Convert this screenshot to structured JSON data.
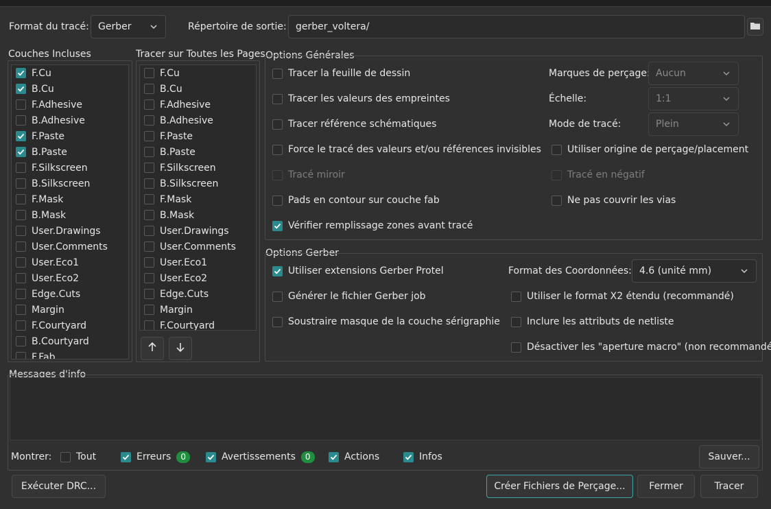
{
  "header": {
    "format_label": "Format du tracé:",
    "format_value": "Gerber",
    "output_dir_label": "Répertoire de sortie:",
    "output_dir_value": "gerber_voltera/"
  },
  "included_layers": {
    "title": "Couches Incluses",
    "items": [
      {
        "label": "F.Cu",
        "checked": true
      },
      {
        "label": "B.Cu",
        "checked": true
      },
      {
        "label": "F.Adhesive",
        "checked": false
      },
      {
        "label": "B.Adhesive",
        "checked": false
      },
      {
        "label": "F.Paste",
        "checked": true
      },
      {
        "label": "B.Paste",
        "checked": true
      },
      {
        "label": "F.Silkscreen",
        "checked": false
      },
      {
        "label": "B.Silkscreen",
        "checked": false
      },
      {
        "label": "F.Mask",
        "checked": false
      },
      {
        "label": "B.Mask",
        "checked": false
      },
      {
        "label": "User.Drawings",
        "checked": false
      },
      {
        "label": "User.Comments",
        "checked": false
      },
      {
        "label": "User.Eco1",
        "checked": false
      },
      {
        "label": "User.Eco2",
        "checked": false
      },
      {
        "label": "Edge.Cuts",
        "checked": false
      },
      {
        "label": "Margin",
        "checked": false
      },
      {
        "label": "F.Courtyard",
        "checked": false
      },
      {
        "label": "B.Courtyard",
        "checked": false
      },
      {
        "label": "F.Fab",
        "checked": false
      }
    ]
  },
  "all_pages_layers": {
    "title": "Tracer sur Toutes les Pages",
    "items": [
      {
        "label": "F.Cu",
        "checked": false
      },
      {
        "label": "B.Cu",
        "checked": false
      },
      {
        "label": "F.Adhesive",
        "checked": false
      },
      {
        "label": "B.Adhesive",
        "checked": false
      },
      {
        "label": "F.Paste",
        "checked": false
      },
      {
        "label": "B.Paste",
        "checked": false
      },
      {
        "label": "F.Silkscreen",
        "checked": false
      },
      {
        "label": "B.Silkscreen",
        "checked": false
      },
      {
        "label": "F.Mask",
        "checked": false
      },
      {
        "label": "B.Mask",
        "checked": false
      },
      {
        "label": "User.Drawings",
        "checked": false
      },
      {
        "label": "User.Comments",
        "checked": false
      },
      {
        "label": "User.Eco1",
        "checked": false
      },
      {
        "label": "User.Eco2",
        "checked": false
      },
      {
        "label": "Edge.Cuts",
        "checked": false
      },
      {
        "label": "Margin",
        "checked": false
      },
      {
        "label": "F.Courtyard",
        "checked": false
      }
    ]
  },
  "general": {
    "title": "Options Générales",
    "left_options": [
      {
        "label": "Tracer la feuille de dessin",
        "checked": false,
        "disabled": false
      },
      {
        "label": "Tracer les valeurs des empreintes",
        "checked": false,
        "disabled": false
      },
      {
        "label": "Tracer référence  schématiques",
        "checked": false,
        "disabled": false
      },
      {
        "label": "Force le tracé des valeurs et/ou références invisibles",
        "checked": false,
        "disabled": false
      },
      {
        "label": "Tracé miroir",
        "checked": false,
        "disabled": true
      },
      {
        "label": "Pads en contour sur couche fab",
        "checked": false,
        "disabled": false
      },
      {
        "label": "Vérifier remplissage zones avant tracé",
        "checked": true,
        "disabled": false
      }
    ],
    "drill_marks_label": "Marques de perçage:",
    "drill_marks_value": "Aucun",
    "scale_label": "Échelle:",
    "scale_value": "1:1",
    "plot_mode_label": "Mode de tracé:",
    "plot_mode_value": "Plein",
    "right_options": [
      {
        "label": "Utiliser origine de perçage/placement",
        "checked": false,
        "disabled": false
      },
      {
        "label": "Tracé en négatif",
        "checked": false,
        "disabled": true
      },
      {
        "label": "Ne pas couvrir les vias",
        "checked": false,
        "disabled": false
      }
    ]
  },
  "gerber": {
    "title": "Options Gerber",
    "left_options": [
      {
        "label": "Utiliser extensions Gerber Protel",
        "checked": true
      },
      {
        "label": "Générer le fichier Gerber job",
        "checked": false
      },
      {
        "label": "Soustraire masque de la couche sérigraphie",
        "checked": false
      }
    ],
    "coord_label": "Format des Coordonnées:",
    "coord_value": "4.6 (unité mm)",
    "right_options": [
      {
        "label": "Utiliser le format X2 étendu (recommandé)",
        "checked": false
      },
      {
        "label": "Inclure les attributs de netliste",
        "checked": false
      },
      {
        "label": "Désactiver les \"aperture macro\" (non recommandé)",
        "checked": false
      }
    ]
  },
  "messages": {
    "title": "Messages d'info",
    "show_label": "Montrer:",
    "filters": [
      {
        "label": "Tout",
        "checked": false,
        "badge": null
      },
      {
        "label": "Erreurs",
        "checked": true,
        "badge": "0"
      },
      {
        "label": "Avertissements",
        "checked": true,
        "badge": "0"
      },
      {
        "label": "Actions",
        "checked": true,
        "badge": null
      },
      {
        "label": "Infos",
        "checked": true,
        "badge": null
      }
    ],
    "save_label": "Sauver..."
  },
  "buttons": {
    "run_drc": "Exécuter DRC...",
    "create_drill": "Créer Fichiers de Perçage...",
    "close": "Fermer",
    "plot": "Tracer"
  },
  "colors": {
    "background": "#303030",
    "accent": "#2a8a8e",
    "badge": "#1f8f3f"
  }
}
